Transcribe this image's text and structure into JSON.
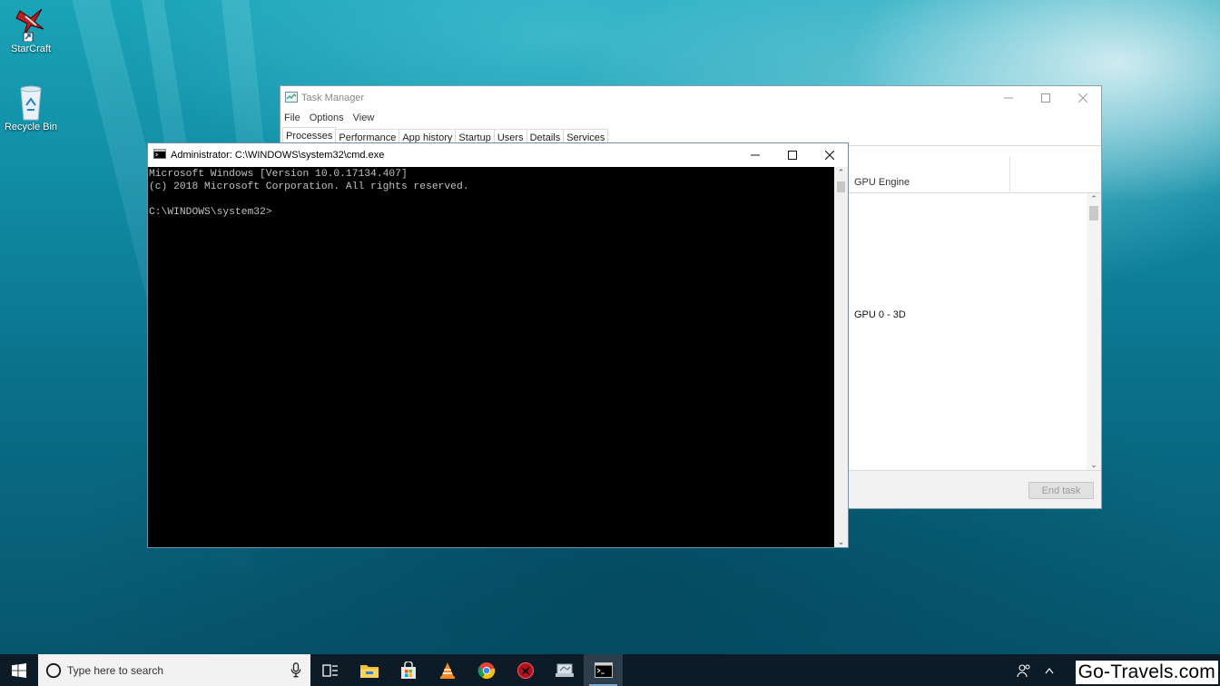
{
  "desktop": {
    "icons": [
      {
        "label": "StarCraft",
        "icon": "starcraft-shortcut-icon"
      },
      {
        "label": "Recycle Bin",
        "icon": "recycle-bin-icon"
      }
    ]
  },
  "task_manager": {
    "title": "Task Manager",
    "menu": [
      "File",
      "Options",
      "View"
    ],
    "tabs": [
      "Processes",
      "Performance",
      "App history",
      "Startup",
      "Users",
      "Details",
      "Services"
    ],
    "active_tab": "Processes",
    "column_header": "GPU Engine",
    "visible_cell": "GPU 0 - 3D",
    "end_task_label": "End task"
  },
  "cmd": {
    "title": "Administrator: C:\\WINDOWS\\system32\\cmd.exe",
    "lines": [
      "Microsoft Windows [Version 10.0.17134.407]",
      "(c) 2018 Microsoft Corporation. All rights reserved.",
      "",
      "C:\\WINDOWS\\system32>"
    ]
  },
  "taskbar": {
    "search_placeholder": "Type here to search",
    "pinned": [
      "task-view-icon",
      "file-explorer-icon",
      "store-icon",
      "vlc-icon",
      "chrome-icon",
      "app-icon",
      "app-icon",
      "command-prompt-icon"
    ],
    "active": "command-prompt-icon"
  },
  "watermark": "Go-Travels.com",
  "colors": {
    "taskbar": "#0d1b26",
    "console_bg": "#000000",
    "console_text": "#c0c0c0"
  }
}
